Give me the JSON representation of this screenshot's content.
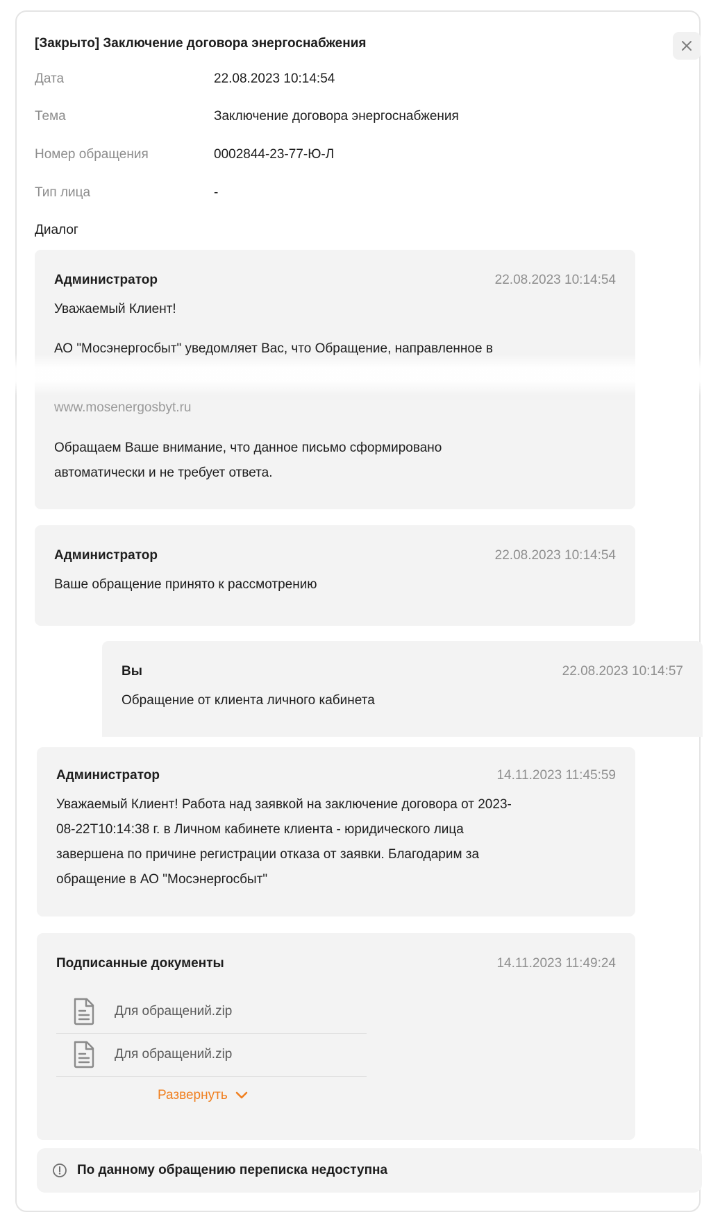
{
  "title": "[Закрыто] Заключение договора энергоснабжения",
  "info": {
    "date_label": "Дата",
    "date_value": "22.08.2023 10:14:54",
    "topic_label": "Тема",
    "topic_value": "Заключение договора энергоснабжения",
    "number_label": "Номер обращения",
    "number_value": "0002844-23-77-Ю-Л",
    "person_label": "Тип лица",
    "person_value": "-"
  },
  "dialog_label": "Диалог",
  "messages": [
    {
      "author": "Администратор",
      "date": "22.08.2023 10:14:54",
      "lines": [
        "Уважаемый Клиент!",
        "АО \"Мосэнергосбыт\" уведомляет Вас, что Обращение, направленное в",
        "www.mosenergosbyt.ru",
        "Обращаем Ваше внимание, что данное письмо сформировано",
        "автоматически и не требует ответа."
      ]
    },
    {
      "author": "Администратор",
      "date": "22.08.2023 10:14:54",
      "lines": [
        "Ваше обращение принято к рассмотрению"
      ]
    },
    {
      "author": "Вы",
      "date": "22.08.2023 10:14:57",
      "lines": [
        "Обращение от клиента личного кабинета"
      ]
    },
    {
      "author": "Администратор",
      "date": "14.11.2023 11:45:59",
      "lines": [
        "Уважаемый Клиент! Работа над заявкой на заключение договора от 2023-",
        "08-22T10:14:38 г. в Личном кабинете клиента - юридического лица",
        "завершена по причине регистрации отказа от заявки. Благодарим за",
        "обращение в АО \"Мосэнергосбыт\""
      ]
    }
  ],
  "documents": {
    "title": "Подписанные документы",
    "date": "14.11.2023 11:49:24",
    "files": [
      "Для обращений.zip",
      "Для обращений.zip"
    ],
    "expand_label": "Развернуть",
    "accent_color": "#f07f1f"
  },
  "notice": "По данному обращению переписка недоступна",
  "icons": {
    "close": "close-icon",
    "file": "file-icon",
    "chevron": "chevron-down-icon",
    "info": "info-icon"
  }
}
